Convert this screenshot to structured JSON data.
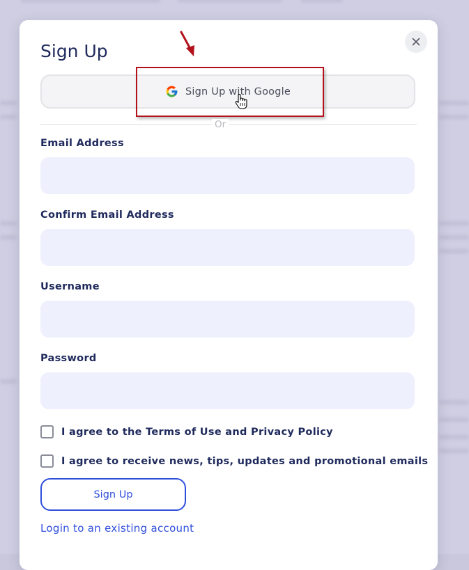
{
  "modal": {
    "title": "Sign Up",
    "close_icon": "close-icon"
  },
  "google": {
    "label": "Sign Up with Google",
    "icon": "google-g-icon"
  },
  "divider_text": "Or",
  "fields": {
    "email_label": "Email Address",
    "email_value": "",
    "confirm_email_label": "Confirm Email Address",
    "confirm_email_value": "",
    "username_label": "Username",
    "username_value": "",
    "password_label": "Password",
    "password_value": ""
  },
  "checks": {
    "terms_label": "I agree to the Terms of Use and Privacy Policy",
    "news_label": "I agree to receive news, tips, updates and promotional emails"
  },
  "actions": {
    "signup_label": "Sign Up",
    "login_link": "Login to an existing account"
  },
  "colors": {
    "title": "#1f2a5c",
    "accent": "#2f4fdb",
    "input_bg": "#eef0fd",
    "highlight": "#b3121d"
  }
}
